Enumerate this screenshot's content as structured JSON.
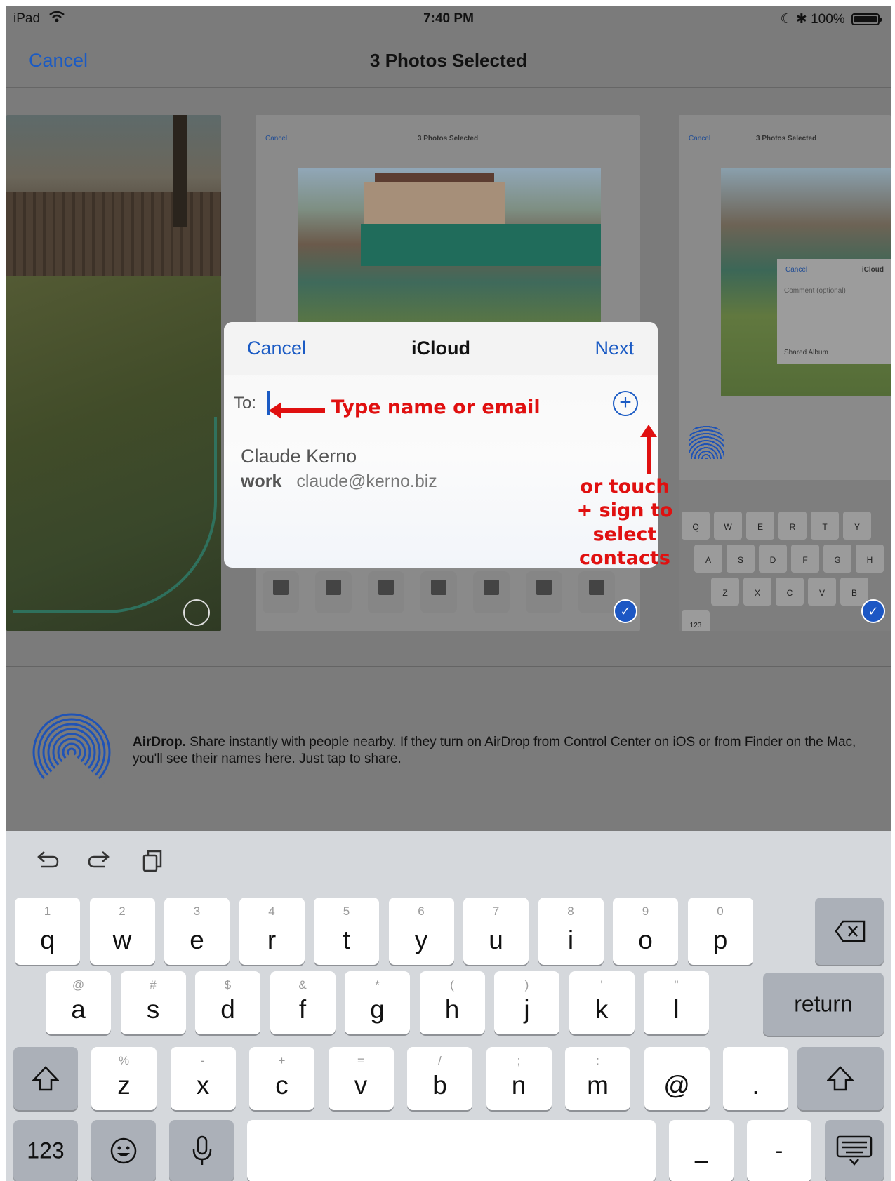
{
  "status_bar": {
    "device": "iPad",
    "time": "7:40 PM",
    "battery": "100%"
  },
  "nav": {
    "cancel": "Cancel",
    "title": "3 Photos Selected"
  },
  "thumb_nav": {
    "cancel": "Cancel",
    "title": "3 Photos Selected"
  },
  "photo3_popover": {
    "cancel": "Cancel",
    "title": "iCloud",
    "comment_placeholder": "Comment (optional)",
    "album": "Shared Album"
  },
  "share_sheet": {
    "cancel": "Cancel",
    "title": "iCloud",
    "next": "Next",
    "to_label": "To:",
    "add_symbol": "+",
    "contact": {
      "name": "Claude Kerno",
      "type": "work",
      "email": "claude@kerno.biz"
    }
  },
  "annotations": {
    "type_hint": "Type name or email",
    "touch_hint": [
      "or touch",
      "+ sign to",
      "select",
      "contacts"
    ]
  },
  "airdrop": {
    "heading": "AirDrop.",
    "text": "Share instantly with people nearby. If they turn on AirDrop from Control Center on iOS or from Finder on the Mac, you'll see their names here. Just tap to share."
  },
  "keyboard": {
    "tools": [
      "undo-icon",
      "redo-icon",
      "paste-icon"
    ],
    "row1": [
      {
        "hint": "1",
        "key": "q"
      },
      {
        "hint": "2",
        "key": "w"
      },
      {
        "hint": "3",
        "key": "e"
      },
      {
        "hint": "4",
        "key": "r"
      },
      {
        "hint": "5",
        "key": "t"
      },
      {
        "hint": "6",
        "key": "y"
      },
      {
        "hint": "7",
        "key": "u"
      },
      {
        "hint": "8",
        "key": "i"
      },
      {
        "hint": "9",
        "key": "o"
      },
      {
        "hint": "0",
        "key": "p"
      }
    ],
    "row2": [
      {
        "hint": "@",
        "key": "a"
      },
      {
        "hint": "#",
        "key": "s"
      },
      {
        "hint": "$",
        "key": "d"
      },
      {
        "hint": "&",
        "key": "f"
      },
      {
        "hint": "*",
        "key": "g"
      },
      {
        "hint": "(",
        "key": "h"
      },
      {
        "hint": ")",
        "key": "j"
      },
      {
        "hint": "'",
        "key": "k"
      },
      {
        "hint": "\"",
        "key": "l"
      }
    ],
    "row3": [
      {
        "hint": "%",
        "key": "z"
      },
      {
        "hint": "-",
        "key": "x"
      },
      {
        "hint": "+",
        "key": "c"
      },
      {
        "hint": "=",
        "key": "v"
      },
      {
        "hint": "/",
        "key": "b"
      },
      {
        "hint": ";",
        "key": "n"
      },
      {
        "hint": ":",
        "key": "m"
      },
      {
        "hint": "",
        "key": "@"
      },
      {
        "hint": "",
        "key": "."
      }
    ],
    "return_label": "return",
    "numbers_label": "123",
    "underscore": "_",
    "dash": "-"
  }
}
